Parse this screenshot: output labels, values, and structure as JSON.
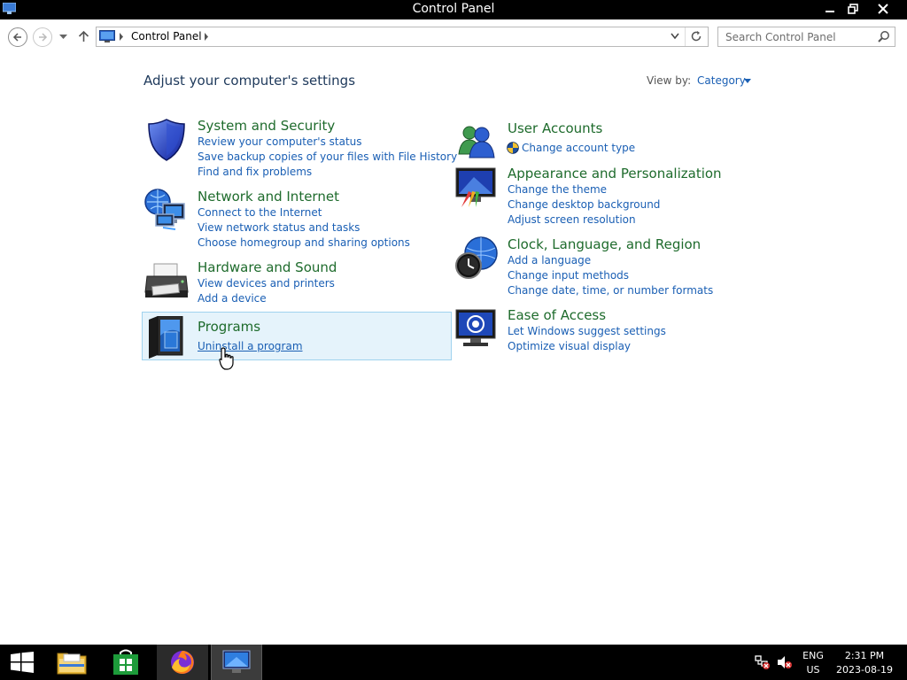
{
  "window": {
    "title": "Control Panel"
  },
  "address": {
    "crumb": "Control Panel",
    "search_placeholder": "Search Control Panel"
  },
  "main": {
    "heading": "Adjust your computer's settings",
    "view_by_label": "View by:",
    "view_by_value": "Category"
  },
  "categories": [
    {
      "title": "System and Security",
      "icon": "shield-icon",
      "links": [
        "Review your computer's status",
        "Save backup copies of your files with File History",
        "Find and fix problems"
      ]
    },
    {
      "title": "Network and Internet",
      "icon": "network-icon",
      "links": [
        "Connect to the Internet",
        "View network status and tasks",
        "Choose homegroup and sharing options"
      ]
    },
    {
      "title": "Hardware and Sound",
      "icon": "printer-icon",
      "links": [
        "View devices and printers",
        "Add a device"
      ]
    },
    {
      "title": "Programs",
      "icon": "programs-icon",
      "links": [
        "Uninstall a program"
      ]
    },
    {
      "title": "User Accounts",
      "icon": "users-icon",
      "links": [
        "Change account type"
      ]
    },
    {
      "title": "Appearance and Personalization",
      "icon": "appearance-icon",
      "links": [
        "Change the theme",
        "Change desktop background",
        "Adjust screen resolution"
      ]
    },
    {
      "title": "Clock, Language, and Region",
      "icon": "clock-icon",
      "links": [
        "Add a language",
        "Change input methods",
        "Change date, time, or number formats"
      ]
    },
    {
      "title": "Ease of Access",
      "icon": "ease-of-access-icon",
      "links": [
        "Let Windows suggest settings",
        "Optimize visual display"
      ]
    }
  ],
  "taskbar": {
    "lang_top": "ENG",
    "lang_bottom": "US",
    "time": "2:31 PM",
    "date": "2023-08-19"
  },
  "colors": {
    "category_title": "#1e6b2c",
    "link": "#1a5fb4",
    "heading": "#1e395b",
    "highlight": "#e5f3fb"
  }
}
